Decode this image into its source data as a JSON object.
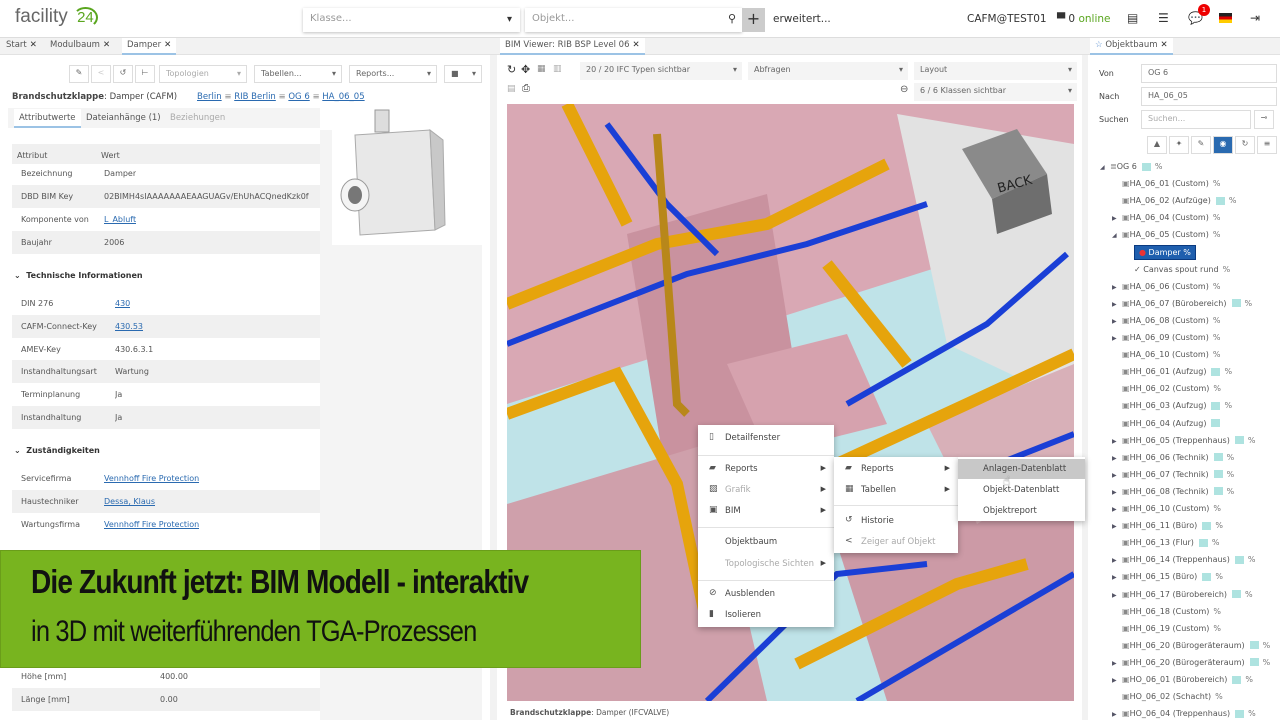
{
  "header": {
    "logo_text": "facility",
    "logo_num": "24",
    "klasse_placeholder": "Klasse...",
    "objekt_placeholder": "Objekt...",
    "plus": "+",
    "advanced": "erweitert...",
    "user": "CAFM@TEST01",
    "online_count": "0",
    "online_label": "online",
    "notification_count": "1"
  },
  "tabs_left": [
    {
      "label": "Start"
    },
    {
      "label": "Modulbaum"
    },
    {
      "label": "Damper"
    }
  ],
  "tab_middle": "BIM Viewer: RIB BSP Level 06",
  "tab_right": "Objektbaum",
  "left": {
    "toolbar": {
      "topologien": "Topologien",
      "tabellen": "Tabellen...",
      "reports": "Reports..."
    },
    "title_bold": "Brandschutzklappe",
    "title_rest": "Damper (CAFM)",
    "breadcrumb": [
      "Berlin",
      "RIB Berlin",
      "OG 6",
      "HA_06_05"
    ],
    "subtabs": [
      "Attributwerte",
      "Dateianhänge (1)",
      "Beziehungen"
    ],
    "table_header": [
      "Attribut",
      "Wert"
    ],
    "general": [
      {
        "k": "Bezeichnung",
        "v": "Damper"
      },
      {
        "k": "DBD BIM Key",
        "v": "02BIMH4sIAAAAAAAEAAGUAGv/EhUhACQnedKzk0f"
      },
      {
        "k": "Komponente von",
        "v": "L_Abluft",
        "link": true
      },
      {
        "k": "Baujahr",
        "v": "2006"
      }
    ],
    "tech_title": "Technische Informationen",
    "tech": [
      {
        "k": "DIN 276",
        "v": "430",
        "link": true
      },
      {
        "k": "CAFM-Connect-Key",
        "v": "430.53",
        "link": true
      },
      {
        "k": "AMEV-Key",
        "v": "430.6.3.1"
      },
      {
        "k": "Instandhaltungsart",
        "v": "Wartung"
      },
      {
        "k": "Terminplanung",
        "v": "Ja"
      },
      {
        "k": "Instandhaltung",
        "v": "Ja"
      }
    ],
    "resp_title": "Zuständigkeiten",
    "resp": [
      {
        "k": "Servicefirma",
        "v": "Vennhoff Fire Protection",
        "link": true
      },
      {
        "k": "Haustechniker",
        "v": "Dessa, Klaus",
        "link": true
      },
      {
        "k": "Wartungsfirma",
        "v": "Vennhoff Fire Protection",
        "link": true
      }
    ],
    "dims": [
      {
        "k": "Höhe [mm]",
        "v": "400.00"
      },
      {
        "k": "Länge [mm]",
        "v": "0.00"
      }
    ]
  },
  "viewer": {
    "ifc_types": "20 / 20 IFC Typen sichtbar",
    "abfragen": "Abfragen",
    "layout": "Layout",
    "klassen": "6 / 6 Klassen sichtbar",
    "cube_label": "BACK",
    "status_bold": "Brandschutzklappe",
    "status_rest": "Damper (IFCVALVE)"
  },
  "context_menu": {
    "main": [
      "Detailfenster",
      "Reports",
      "Grafik",
      "BIM",
      "Objektbaum",
      "Topologische Sichten",
      "Ausblenden",
      "Isolieren"
    ],
    "sub": [
      "Reports",
      "Tabellen",
      "Historie",
      "Zeiger auf Objekt"
    ],
    "subsub": [
      "Anlagen-Datenblatt",
      "Objekt-Datenblatt",
      "Objektreport"
    ]
  },
  "right": {
    "von_label": "Von",
    "von_value": "OG 6",
    "nach_label": "Nach",
    "nach_value": "HA_06_05",
    "suchen_label": "Suchen",
    "suchen_placeholder": "Suchen...",
    "tree": [
      {
        "t": "OG 6",
        "lvl": 0,
        "exp": "open",
        "tag": true,
        "pct": true
      },
      {
        "t": "HA_06_01 (Custom)",
        "lvl": 1,
        "pct": true
      },
      {
        "t": "HA_06_02 (Aufzüge)",
        "lvl": 1,
        "tag": true,
        "pct": true
      },
      {
        "t": "HA_06_04 (Custom)",
        "lvl": 1,
        "exp": "closed",
        "pct": true
      },
      {
        "t": "HA_06_05 (Custom)",
        "lvl": 1,
        "exp": "open",
        "pct": true
      },
      {
        "t": "Damper",
        "lvl": 2,
        "selected": true,
        "pct": true
      },
      {
        "t": "Canvas spout rund",
        "lvl": 2,
        "check": true,
        "pct": true
      },
      {
        "t": "HA_06_06 (Custom)",
        "lvl": 1,
        "exp": "closed",
        "pct": true
      },
      {
        "t": "HA_06_07 (Bürobereich)",
        "lvl": 1,
        "exp": "closed",
        "tag": true,
        "pct": true
      },
      {
        "t": "HA_06_08 (Custom)",
        "lvl": 1,
        "exp": "closed",
        "pct": true
      },
      {
        "t": "HA_06_09 (Custom)",
        "lvl": 1,
        "exp": "closed",
        "pct": true
      },
      {
        "t": "HA_06_10 (Custom)",
        "lvl": 1,
        "pct": true
      },
      {
        "t": "HH_06_01 (Aufzug)",
        "lvl": 1,
        "tag": true,
        "pct": true
      },
      {
        "t": "HH_06_02 (Custom)",
        "lvl": 1,
        "pct": true
      },
      {
        "t": "HH_06_03 (Aufzug)",
        "lvl": 1,
        "tag": true,
        "pct": true
      },
      {
        "t": "HH_06_04 (Aufzug)",
        "lvl": 1,
        "tag": true
      },
      {
        "t": "HH_06_05 (Treppenhaus)",
        "lvl": 1,
        "exp": "closed",
        "tag": true,
        "pct": true
      },
      {
        "t": "HH_06_06 (Technik)",
        "lvl": 1,
        "exp": "closed",
        "tag": true,
        "pct": true
      },
      {
        "t": "HH_06_07 (Technik)",
        "lvl": 1,
        "exp": "closed",
        "tag": true,
        "pct": true
      },
      {
        "t": "HH_06_08 (Technik)",
        "lvl": 1,
        "exp": "closed",
        "tag": true,
        "pct": true
      },
      {
        "t": "HH_06_10 (Custom)",
        "lvl": 1,
        "exp": "closed",
        "pct": true
      },
      {
        "t": "HH_06_11 (Büro)",
        "lvl": 1,
        "exp": "closed",
        "tag": true,
        "pct": true
      },
      {
        "t": "HH_06_13 (Flur)",
        "lvl": 1,
        "tag": true,
        "pct": true
      },
      {
        "t": "HH_06_14 (Treppenhaus)",
        "lvl": 1,
        "exp": "closed",
        "tag": true,
        "pct": true
      },
      {
        "t": "HH_06_15 (Büro)",
        "lvl": 1,
        "exp": "closed",
        "tag": true,
        "pct": true
      },
      {
        "t": "HH_06_17 (Bürobereich)",
        "lvl": 1,
        "exp": "closed",
        "tag": true,
        "pct": true
      },
      {
        "t": "HH_06_18 (Custom)",
        "lvl": 1,
        "pct": true
      },
      {
        "t": "HH_06_19 (Custom)",
        "lvl": 1,
        "pct": true
      },
      {
        "t": "HH_06_20 (Bürogeräteraum)",
        "lvl": 1,
        "tag": true,
        "pct": true
      },
      {
        "t": "HH_06_20 (Bürogeräteraum)",
        "lvl": 1,
        "exp": "closed",
        "tag": true,
        "pct": true
      },
      {
        "t": "HO_06_01 (Bürobereich)",
        "lvl": 1,
        "exp": "closed",
        "tag": true,
        "pct": true
      },
      {
        "t": "HO_06_02 (Schacht)",
        "lvl": 1,
        "pct": true
      },
      {
        "t": "HO_06_04 (Treppenhaus)",
        "lvl": 1,
        "exp": "closed",
        "tag": true,
        "pct": true
      }
    ]
  },
  "banner": {
    "line1": "Die Zukunft jetzt: BIM Modell - interaktiv",
    "line2": "in 3D mit weiterführenden TGA-Prozessen"
  },
  "colors": {
    "banner": "#78b41f",
    "accent": "#2a6ab0",
    "online": "#5aa61f",
    "selected": "#1f5fae"
  }
}
